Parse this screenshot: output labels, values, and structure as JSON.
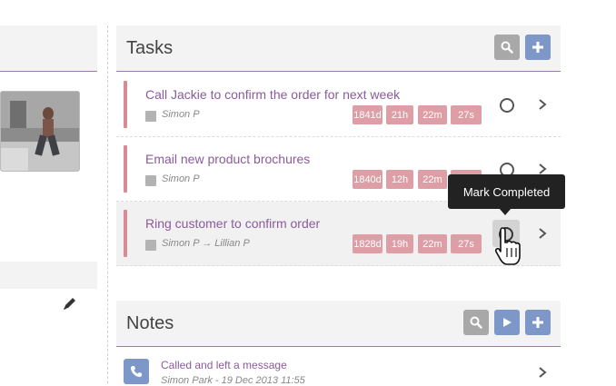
{
  "tasks_panel": {
    "title": "Tasks",
    "items": [
      {
        "title": "Call Jackie to confirm the order for next week",
        "assignee": "Simon P",
        "timer": [
          "1841d",
          "21h",
          "22m",
          "27s"
        ]
      },
      {
        "title": "Email new product brochures",
        "assignee": "Simon P",
        "timer": [
          "1840d",
          "12h",
          "22m",
          ""
        ]
      },
      {
        "title": "Ring customer to confirm order",
        "assignee": "Simon P → Lillian P",
        "timer": [
          "1828d",
          "19h",
          "22m",
          "27s"
        ]
      }
    ]
  },
  "tooltip": {
    "text": "Mark Completed"
  },
  "notes_panel": {
    "title": "Notes",
    "items": [
      {
        "title": "Called and left a message",
        "meta": "Simon Park - 19 Dec 2013 11:55"
      }
    ]
  },
  "icons": {
    "search": "search-icon",
    "add": "plus-icon",
    "play": "play-icon",
    "complete": "circle-icon",
    "open": "chevron-right-icon",
    "edit": "pencil-icon",
    "phone": "phone-icon",
    "cursor": "hand-cursor-icon"
  },
  "colors": {
    "accent_purple": "#8b5b9b",
    "button_blue": "#7d98c8",
    "button_grey": "#a8a8a8",
    "timer_red": "#de9ea6",
    "priority_bar": "#d98a95"
  }
}
